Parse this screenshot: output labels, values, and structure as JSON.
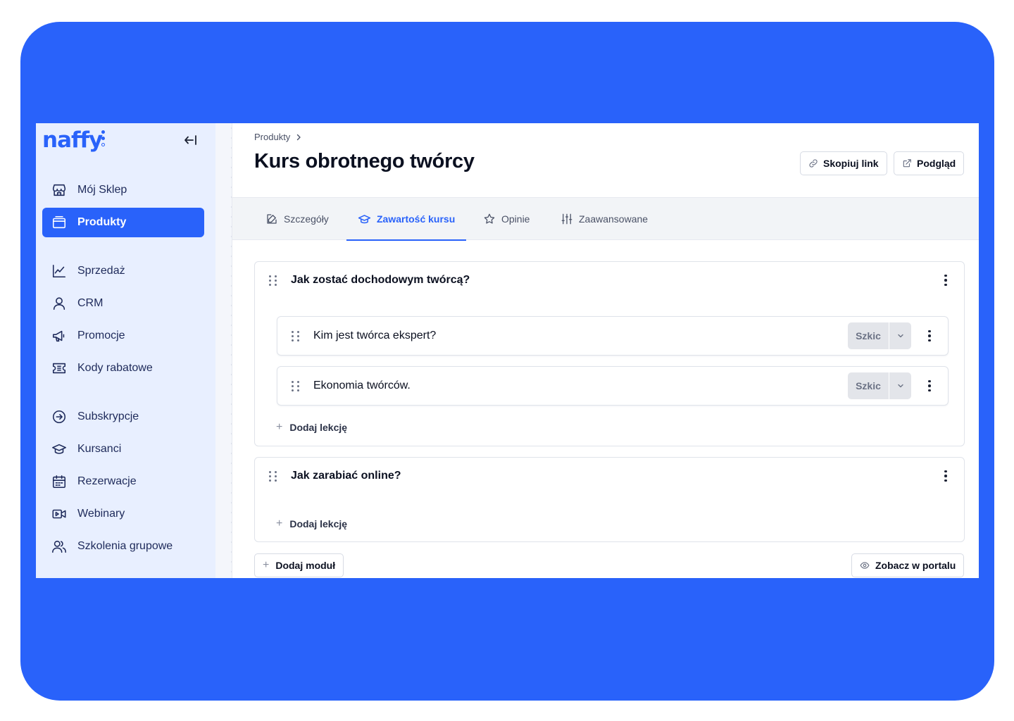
{
  "brand": {
    "logo_text": "naffy",
    "accent": "#2962fa",
    "frame_bg": "#2962fa"
  },
  "sidebar": {
    "items": [
      {
        "label": "Mój Sklep",
        "icon": "store-icon"
      },
      {
        "label": "Produkty",
        "icon": "folder-icon",
        "active": true
      },
      {
        "label": "Sprzedaż",
        "icon": "chart-line-icon"
      },
      {
        "label": "CRM",
        "icon": "user-icon"
      },
      {
        "label": "Promocje",
        "icon": "megaphone-icon"
      },
      {
        "label": "Kody rabatowe",
        "icon": "coupon-icon"
      },
      {
        "label": "Subskrypcje",
        "icon": "subscription-icon"
      },
      {
        "label": "Kursanci",
        "icon": "graduation-cap-icon"
      },
      {
        "label": "Rezerwacje",
        "icon": "calendar-icon"
      },
      {
        "label": "Webinary",
        "icon": "video-icon"
      },
      {
        "label": "Szkolenia grupowe",
        "icon": "users-icon"
      }
    ]
  },
  "header": {
    "breadcrumb": "Produkty",
    "title": "Kurs obrotnego twórcy",
    "copy_link_label": "Skopiuj link",
    "preview_label": "Podgląd"
  },
  "tabs": [
    {
      "label": "Szczegóły",
      "icon": "edit-icon"
    },
    {
      "label": "Zawartość kursu",
      "icon": "graduation-cap-icon",
      "active": true
    },
    {
      "label": "Opinie",
      "icon": "star-icon"
    },
    {
      "label": "Zaawansowane",
      "icon": "sliders-icon"
    }
  ],
  "modules": [
    {
      "title": "Jak zostać dochodowym twórcą?",
      "lessons": [
        {
          "title": "Kim jest twórca ekspert?",
          "status": "Szkic"
        },
        {
          "title": "Ekonomia twórców.",
          "status": "Szkic"
        }
      ],
      "add_lesson_label": "Dodaj lekcję"
    },
    {
      "title": "Jak zarabiać online?",
      "lessons": [],
      "add_lesson_label": "Dodaj lekcję"
    }
  ],
  "footer": {
    "add_module_label": "Dodaj moduł",
    "portal_label": "Zobacz w portalu"
  }
}
